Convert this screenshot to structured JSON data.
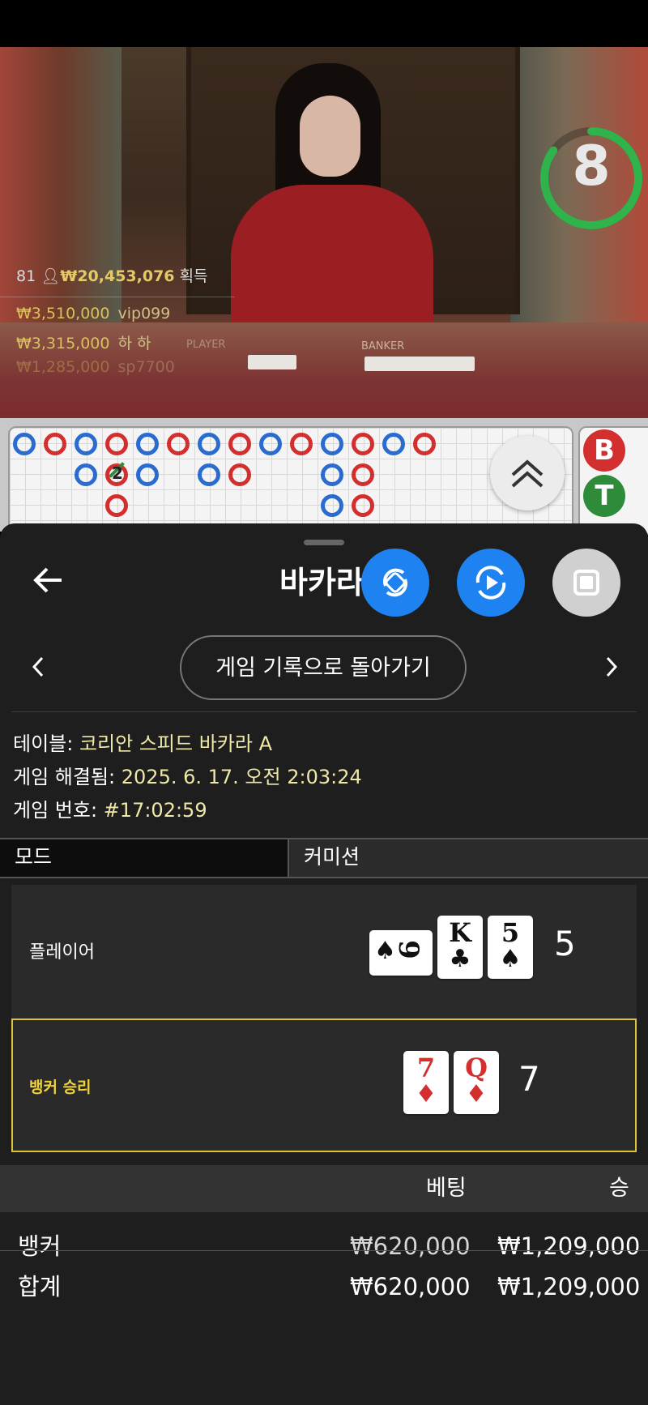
{
  "timer": {
    "count": "8",
    "fraction_remaining": 0.85
  },
  "winners": {
    "players": "81",
    "total": "₩20,453,076",
    "total_suffix": "획득",
    "rows": [
      {
        "amount": "₩3,510,000",
        "name": "vip099"
      },
      {
        "amount": "₩3,315,000",
        "name": "하 하"
      },
      {
        "amount": "₩1,285,000",
        "name": "sp7700"
      }
    ]
  },
  "video": {
    "player_label": "PLAYER",
    "banker_label": "BANKER"
  },
  "roads": {
    "bead_b": "B",
    "bead_t": "T",
    "tie_count": "2"
  },
  "header": {
    "title": "바카라",
    "back_to_history": "게임 기록으로 돌아가기"
  },
  "details": {
    "table_label": "테이블:",
    "table_value": "코리안 스피드 바카라 A",
    "resolved_label": "게임 해결됨:",
    "resolved_value": "2025. 6. 17. 오전 2:03:24",
    "number_label": "게임 번호:",
    "number_value": "#17:02:59"
  },
  "tabs": {
    "mode": "모드",
    "commission": "커미션"
  },
  "hands": {
    "player": {
      "label": "플레이어",
      "score": "5",
      "cards": [
        {
          "rank": "9",
          "suit": "♠",
          "color": "#111111",
          "sideways": true
        },
        {
          "rank": "K",
          "suit": "♣",
          "color": "#111111"
        },
        {
          "rank": "5",
          "suit": "♠",
          "color": "#111111"
        }
      ]
    },
    "banker": {
      "label": "뱅커 승리",
      "score": "7",
      "cards": [
        {
          "rank": "7",
          "suit": "♦",
          "color": "#d32f2f"
        },
        {
          "rank": "Q",
          "suit": "♦",
          "color": "#d32f2f"
        }
      ]
    }
  },
  "bets": {
    "col_bet": "베팅",
    "col_win": "승",
    "rows": [
      {
        "label": "뱅커",
        "bet": "₩620,000",
        "win": "₩1,209,000"
      },
      {
        "label": "합계",
        "bet": "₩620,000",
        "win": "₩1,209,000"
      }
    ]
  },
  "colors": {
    "accent_blue": "#1e82f0",
    "win_yellow": "#e1c23a",
    "banker_red": "#d32f2f",
    "player_blue": "#2a6bd0"
  }
}
